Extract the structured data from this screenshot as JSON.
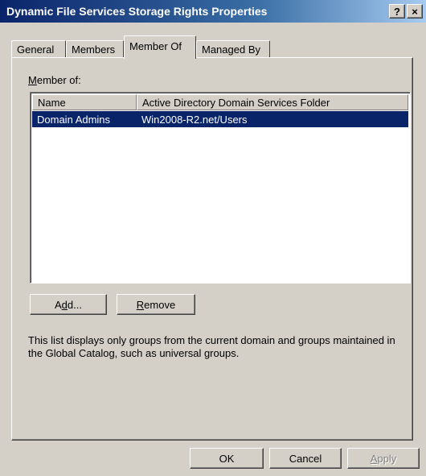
{
  "window": {
    "title": "Dynamic File Services Storage Rights Properties",
    "help_button": "?",
    "close_button": "×"
  },
  "tabs": [
    {
      "label": "General",
      "active": false
    },
    {
      "label": "Members",
      "active": false
    },
    {
      "label": "Member Of",
      "active": true
    },
    {
      "label": "Managed By",
      "active": false
    }
  ],
  "member_of": {
    "label_prefix": "M",
    "label_rest": "ember of:",
    "columns": [
      "Name",
      "Active Directory Domain Services Folder"
    ],
    "rows": [
      {
        "name": "Domain Admins",
        "folder": "Win2008-R2.net/Users",
        "selected": true
      }
    ],
    "add_button": {
      "before": "A",
      "underlined": "d",
      "after": "d..."
    },
    "remove_button": {
      "underlined": "R",
      "after": "emove"
    },
    "help_text": "This list displays only groups from the current domain and groups maintained in the Global Catalog, such as universal groups."
  },
  "footer": {
    "ok": "OK",
    "cancel": "Cancel",
    "apply_underlined": "A",
    "apply_rest": "pply"
  }
}
